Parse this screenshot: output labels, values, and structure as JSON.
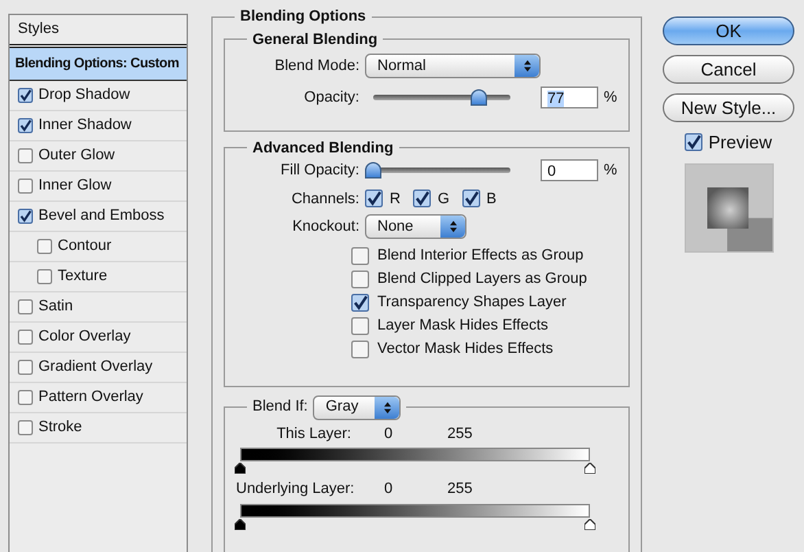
{
  "styles_panel": {
    "title": "Styles",
    "header_item": {
      "label": "Blending Options: Custom",
      "selected": true
    },
    "items": [
      {
        "label": "Drop Shadow",
        "checked": true,
        "selected": false
      },
      {
        "label": "Inner Shadow",
        "checked": true,
        "selected": false
      },
      {
        "label": "Outer Glow",
        "checked": false,
        "selected": false
      },
      {
        "label": "Inner Glow",
        "checked": false,
        "selected": false
      },
      {
        "label": "Bevel and Emboss",
        "checked": true,
        "selected": false,
        "children": [
          {
            "label": "Contour",
            "checked": false,
            "selected": false
          },
          {
            "label": "Texture",
            "checked": false,
            "selected": false
          }
        ]
      },
      {
        "label": "Satin",
        "checked": false,
        "selected": false
      },
      {
        "label": "Color Overlay",
        "checked": false,
        "selected": false
      },
      {
        "label": "Gradient Overlay",
        "checked": false,
        "selected": false
      },
      {
        "label": "Pattern Overlay",
        "checked": false,
        "selected": false
      },
      {
        "label": "Stroke",
        "checked": false,
        "selected": false
      }
    ]
  },
  "blending_options": {
    "title": "Blending Options",
    "general": {
      "title": "General Blending",
      "blend_mode": {
        "label": "Blend Mode:",
        "value": "Normal"
      },
      "opacity": {
        "label": "Opacity:",
        "level": 0.77,
        "value": "77",
        "unit": "%"
      }
    },
    "advanced": {
      "title": "Advanced Blending",
      "fill_opacity": {
        "label": "Fill Opacity:",
        "level": 0,
        "value": "0",
        "unit": "%"
      },
      "channels": {
        "label": "Channels:",
        "items": [
          {
            "label": "R",
            "checked": true
          },
          {
            "label": "G",
            "checked": true
          },
          {
            "label": "B",
            "checked": true
          }
        ]
      },
      "knockout": {
        "label": "Knockout:",
        "value": "None"
      },
      "options": [
        {
          "label": "Blend Interior Effects as Group",
          "checked": false
        },
        {
          "label": "Blend Clipped Layers as Group",
          "checked": false
        },
        {
          "label": "Transparency Shapes Layer",
          "checked": true
        },
        {
          "label": "Layer Mask Hides Effects",
          "checked": false
        },
        {
          "label": "Vector Mask Hides Effects",
          "checked": false
        }
      ]
    },
    "blend_if": {
      "label": "Blend If:",
      "value": "Gray",
      "layers": [
        {
          "label": "This Layer:",
          "min": "0",
          "max": "255"
        },
        {
          "label": "Underlying Layer:",
          "min": "0",
          "max": "255"
        }
      ]
    }
  },
  "buttons": [
    {
      "label": "OK",
      "kind": "default"
    },
    {
      "label": "Cancel",
      "kind": "normal"
    },
    {
      "label": "New Style...",
      "kind": "normal"
    }
  ],
  "preview": {
    "label": "Preview",
    "checked": true
  }
}
